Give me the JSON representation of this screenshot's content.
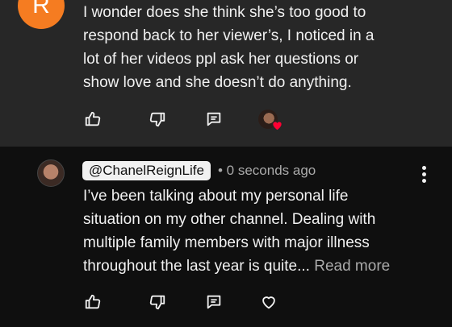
{
  "comment1": {
    "avatar_letter": "R",
    "text": "I wonder does she think she’s too good to\nrespond back to her viewer’s, I noticed in a\nlot of her videos ppl ask her questions or\nshow love and she doesn’t do anything."
  },
  "comment2": {
    "handle": "@ChanelReignLife",
    "time": "• 0 seconds ago",
    "text": "I’ve been talking about my personal life\nsituation on my other channel. Dealing with\nmultiple family members with major illness\nthroughout the last year is quite...",
    "read_more": " Read more"
  },
  "icons": {
    "like": "thumbs-up-icon",
    "dislike": "thumbs-down-icon",
    "reply": "reply-icon",
    "heart": "heart-icon",
    "more": "more-vertical-icon"
  },
  "colors": {
    "top_background": "#272727",
    "bottom_background": "#0f0f0f",
    "avatar_orange": "#f57c21",
    "heart_red": "#ff0033",
    "secondary_text": "#aaaaaa"
  }
}
